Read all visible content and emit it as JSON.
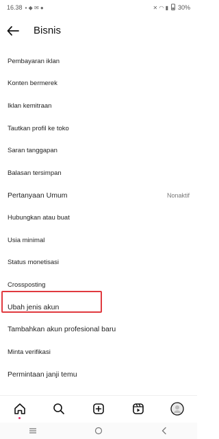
{
  "status": {
    "time": "16.38",
    "battery": "30%"
  },
  "header": {
    "title": "Bisnis"
  },
  "menu": [
    {
      "label": "Pembayaran iklan"
    },
    {
      "label": "Konten bermerek"
    },
    {
      "label": "Iklan kemitraan"
    },
    {
      "label": "Tautkan profil ke toko"
    },
    {
      "label": "Saran tanggapan"
    },
    {
      "label": "Balasan tersimpan"
    },
    {
      "label": "Pertanyaan Umum",
      "value": "Nonaktif"
    },
    {
      "label": "Hubungkan atau buat"
    },
    {
      "label": "Usia minimal"
    },
    {
      "label": "Status monetisasi"
    },
    {
      "label": "Crossposting"
    },
    {
      "label": "Ubah jenis akun"
    },
    {
      "label": "Tambahkan akun profesional baru"
    },
    {
      "label": "Minta verifikasi"
    },
    {
      "label": "Permintaan janji temu"
    }
  ],
  "bottom_nav": [
    "home-icon",
    "search-icon",
    "create-icon",
    "reels-icon",
    "profile-avatar"
  ],
  "colors": {
    "highlight": "#e0393e",
    "notification_dot": "#e1306c"
  }
}
